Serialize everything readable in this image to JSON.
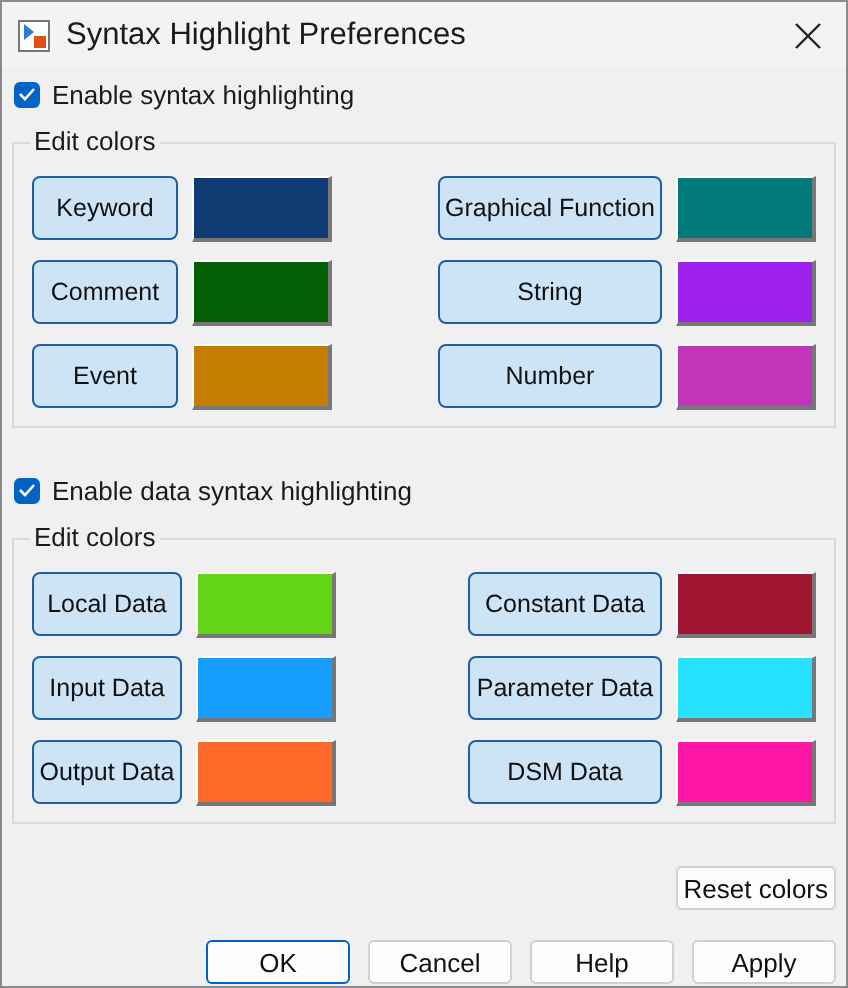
{
  "window": {
    "title": "Syntax Highlight Preferences"
  },
  "sections": [
    {
      "enable": {
        "label": "Enable syntax highlighting",
        "checked": true
      },
      "group": {
        "title": "Edit colors",
        "items": [
          {
            "label": "Keyword",
            "color": "#0f3b72"
          },
          {
            "label": "Graphical Function",
            "color": "#007a7a"
          },
          {
            "label": "Comment",
            "color": "#035f06"
          },
          {
            "label": "String",
            "color": "#a020f0"
          },
          {
            "label": "Event",
            "color": "#c57f00"
          },
          {
            "label": "Number",
            "color": "#c235b8"
          }
        ]
      }
    },
    {
      "enable": {
        "label": "Enable data syntax highlighting",
        "checked": true
      },
      "group": {
        "title": "Edit colors",
        "items": [
          {
            "label": "Local Data",
            "color": "#64d615"
          },
          {
            "label": "Constant Data",
            "color": "#a0152f"
          },
          {
            "label": "Input Data",
            "color": "#169fff"
          },
          {
            "label": "Parameter Data",
            "color": "#25e2ff"
          },
          {
            "label": "Output Data",
            "color": "#ff6a2a"
          },
          {
            "label": "DSM Data",
            "color": "#ff18a6"
          }
        ]
      }
    }
  ],
  "reset_button": "Reset colors",
  "buttons": [
    {
      "label": "OK",
      "default": true
    },
    {
      "label": "Cancel",
      "default": false
    },
    {
      "label": "Help",
      "default": false
    },
    {
      "label": "Apply",
      "default": false
    }
  ]
}
